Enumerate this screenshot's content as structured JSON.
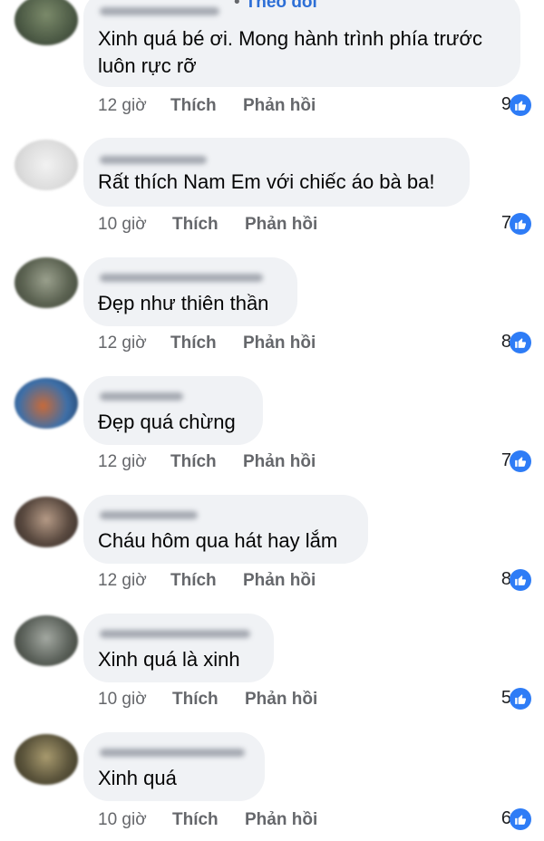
{
  "follow_label": "Theo dõi",
  "follow_dot": "•",
  "comments": [
    {
      "text_lines": [
        "Xinh quá bé ơi. Mong hành trình phía trước",
        "luôn rực rỡ"
      ],
      "time": "12 giờ",
      "like_label": "Thích",
      "reply_label": "Phản hồi",
      "reactions": "9"
    },
    {
      "text_lines": [
        "Rất thích Nam Em với chiếc áo bà ba!"
      ],
      "time": "10 giờ",
      "like_label": "Thích",
      "reply_label": "Phản hồi",
      "reactions": "7"
    },
    {
      "text_lines": [
        "Đẹp như thiên thần"
      ],
      "time": "12 giờ",
      "like_label": "Thích",
      "reply_label": "Phản hồi",
      "reactions": "8"
    },
    {
      "text_lines": [
        "Đẹp quá chừng"
      ],
      "time": "12 giờ",
      "like_label": "Thích",
      "reply_label": "Phản hồi",
      "reactions": "7"
    },
    {
      "text_lines": [
        "Cháu hôm qua hát hay lắm"
      ],
      "time": "12 giờ",
      "like_label": "Thích",
      "reply_label": "Phản hồi",
      "reactions": "8"
    },
    {
      "text_lines": [
        "Xinh quá là xinh"
      ],
      "time": "10 giờ",
      "like_label": "Thích",
      "reply_label": "Phản hồi",
      "reactions": "5"
    },
    {
      "text_lines": [
        "Xinh quá"
      ],
      "time": "10 giờ",
      "like_label": "Thích",
      "reply_label": "Phản hồi",
      "reactions": "6"
    }
  ],
  "colors": {
    "bubble": "#f0f2f5",
    "accent": "#2d6fd6",
    "like_icon": "#2e7cf6",
    "meta": "#65676b"
  },
  "icons": {
    "reaction": "thumbs-up-icon"
  }
}
